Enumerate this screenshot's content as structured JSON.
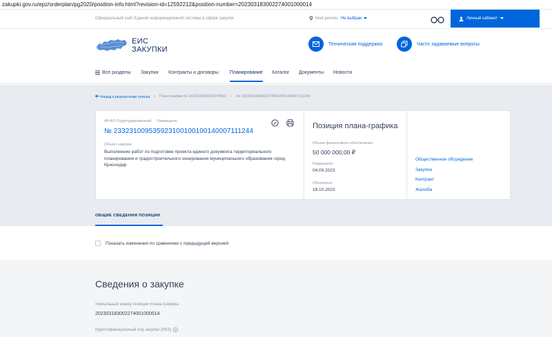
{
  "browser": {
    "url": "zakupki.gov.ru/epz/orderplan/pg2020/position-info.html?revision-id=12592212&position-number=202303183002274001000014"
  },
  "topbar": {
    "official_text": "Официальный сайт Единой информационной системы в сфере закупок",
    "region_label": "Мой регион:",
    "region_value": "Не выбран",
    "cabinet_label": "Личный кабинет"
  },
  "header": {
    "logo_line1": "ЕИС",
    "logo_line2": "ЗАКУПКИ",
    "support_label": "Техническая поддержка",
    "faq_label": "Часто задаваемые вопросы"
  },
  "nav": {
    "all_sections": "Все разделы",
    "items": [
      "Закупки",
      "Контракты и договоры",
      "Планирование",
      "Каталог",
      "Документы",
      "Новости"
    ],
    "active": "Планирование"
  },
  "breadcrumb": {
    "back": "Назад к результатам поиска",
    "plan": "План-график № 202303183002274001",
    "position": "№ 202303183002274001000140007111244"
  },
  "position_card": {
    "tag_law": "44-ФЗ Структурированный",
    "tag_status": "Размещено",
    "number": "№ 233231009535923100100100140007111244",
    "object_label": "Объект закупки",
    "object_text": "Выполнение работ по подготовке проекта единого документа территориального планирования и градостроительного зонирования муниципального образования город Краснодар"
  },
  "plan_card": {
    "title": "Позиция плана-графика",
    "funding_label": "Объем финансового обеспечения",
    "funding_value": "50 000 000,00 ₽",
    "published_label": "Размещено",
    "published_value": "04.09.2023",
    "updated_label": "Обновлено",
    "updated_value": "18.10.2023"
  },
  "side_links": [
    "Общественное обсуждение",
    "Закупка",
    "Контракт",
    "Жалоба"
  ],
  "tabs": {
    "general": "ОБЩИЕ СВЕДЕНИЯ ПОЗИЦИИ"
  },
  "compare_label": "Показать изменения по сравнению с предыдущей версией",
  "details": {
    "section_title": "Сведения о закупке",
    "unique_number_label": "Уникальный номер позиции плана-графика",
    "unique_number_value": "202303183002274001000014",
    "ikz_label": "Идентификационный код закупки (ИКЗ)"
  },
  "colors": {
    "accent": "#0065dd",
    "text": "#334059",
    "muted": "#8a94a6",
    "gray_bg": "#e8ebef"
  }
}
